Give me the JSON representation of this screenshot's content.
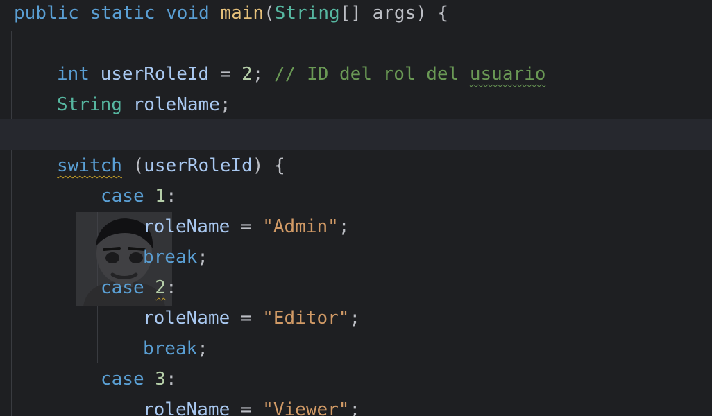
{
  "code": {
    "line1": {
      "kw_public": "public",
      "kw_static": "static",
      "kw_void": "void",
      "fn_main": "main",
      "paren_open": "(",
      "type_string": "String",
      "brackets": "[]",
      "param_args": "args",
      "paren_close": ")",
      "brace": "{"
    },
    "line3": {
      "type_int": "int",
      "var_name": "userRoleId",
      "eq": "=",
      "value": "2",
      "semi": ";",
      "comment_prefix": "// ID del rol del ",
      "comment_word": "usuario"
    },
    "line4": {
      "type_string": "String",
      "var_name": "roleName",
      "semi": ";"
    },
    "line6": {
      "kw_switch": "switch",
      "paren_open": "(",
      "var_name": "userRoleId",
      "paren_close": ")",
      "brace": "{"
    },
    "line7": {
      "kw_case": "case",
      "value": "1",
      "colon": ":"
    },
    "line8": {
      "var_name": "roleName",
      "eq": "=",
      "string": "\"Admin\"",
      "semi": ";"
    },
    "line9": {
      "kw_break": "break",
      "semi": ";"
    },
    "line10": {
      "kw_case": "case",
      "value": "2",
      "colon": ":"
    },
    "line11": {
      "var_name": "roleName",
      "eq": "=",
      "string": "\"Editor\"",
      "semi": ";"
    },
    "line12": {
      "kw_break": "break",
      "semi": ";"
    },
    "line13": {
      "kw_case": "case",
      "value": "3",
      "colon": ":"
    },
    "line14": {
      "var_name": "roleName",
      "eq": "=",
      "string": "\"Viewer\"",
      "semi": ";"
    }
  },
  "colors": {
    "background": "#1e1f22",
    "current_line": "#26282e",
    "keyword": "#5a9fd4",
    "type": "#56b6a0",
    "function": "#e5c07b",
    "string": "#d19a66",
    "number": "#b5cea8",
    "comment": "#6a9955"
  },
  "avatar": {
    "icon": "memoji-avatar-icon"
  }
}
